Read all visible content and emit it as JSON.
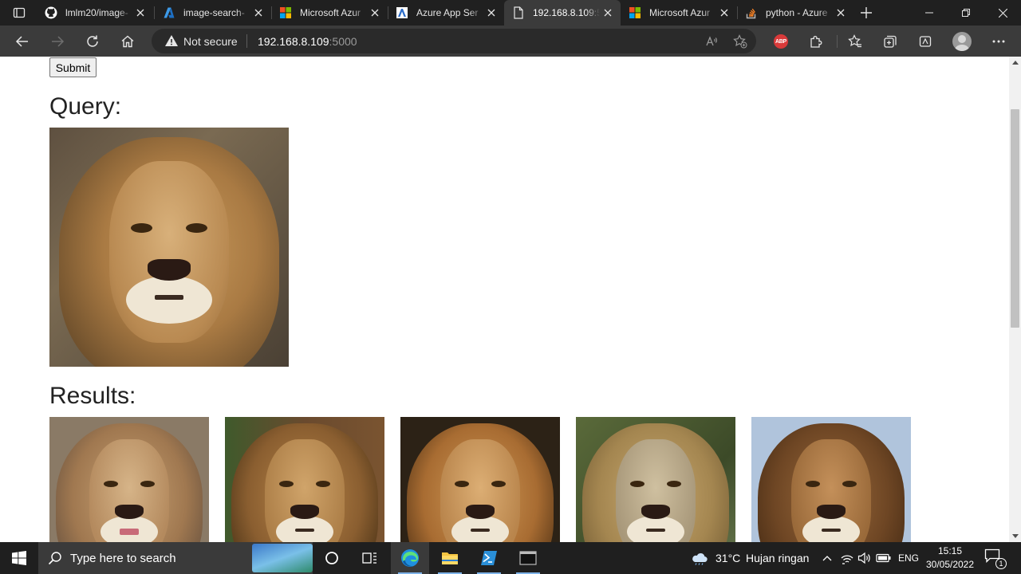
{
  "browser": {
    "tabs": [
      {
        "title": "lmlm20/image-",
        "favicon": "github-icon",
        "active": false
      },
      {
        "title": "image-search-",
        "favicon": "azure-devops-icon",
        "active": false
      },
      {
        "title": "Microsoft Azur",
        "favicon": "microsoft-icon",
        "active": false
      },
      {
        "title": "Azure App Ser",
        "favicon": "azure-app-service-icon",
        "active": false
      },
      {
        "title": "192.168.8.109:5",
        "favicon": "page-icon",
        "active": true
      },
      {
        "title": "Microsoft Azur",
        "favicon": "microsoft-icon",
        "active": false
      },
      {
        "title": "python - Azure",
        "favicon": "stackoverflow-icon",
        "active": false
      }
    ],
    "address": {
      "security_label": "Not secure",
      "host": "192.168.8.109",
      "port": ":5000"
    },
    "extensions": {
      "adblock_label": "ABP"
    }
  },
  "page": {
    "submit_label": "Submit",
    "query_heading": "Query:",
    "results_heading": "Results:",
    "query_image": {
      "subject": "lion"
    },
    "results": [
      {
        "subject": "lion"
      },
      {
        "subject": "lion"
      },
      {
        "subject": "lion"
      },
      {
        "subject": "lion"
      },
      {
        "subject": "lion"
      }
    ]
  },
  "taskbar": {
    "search_placeholder": "Type here to search",
    "weather": {
      "temperature": "31°C",
      "condition": "Hujan ringan"
    },
    "language": "ENG",
    "time": "15:15",
    "date": "30/05/2022",
    "notification_count": "1"
  },
  "colors": {
    "chrome_dark": "#202020",
    "toolbar": "#3b3b3b",
    "page_bg": "#ffffff",
    "taskbar": "#1f1f1f",
    "accent": "#0078d4"
  }
}
